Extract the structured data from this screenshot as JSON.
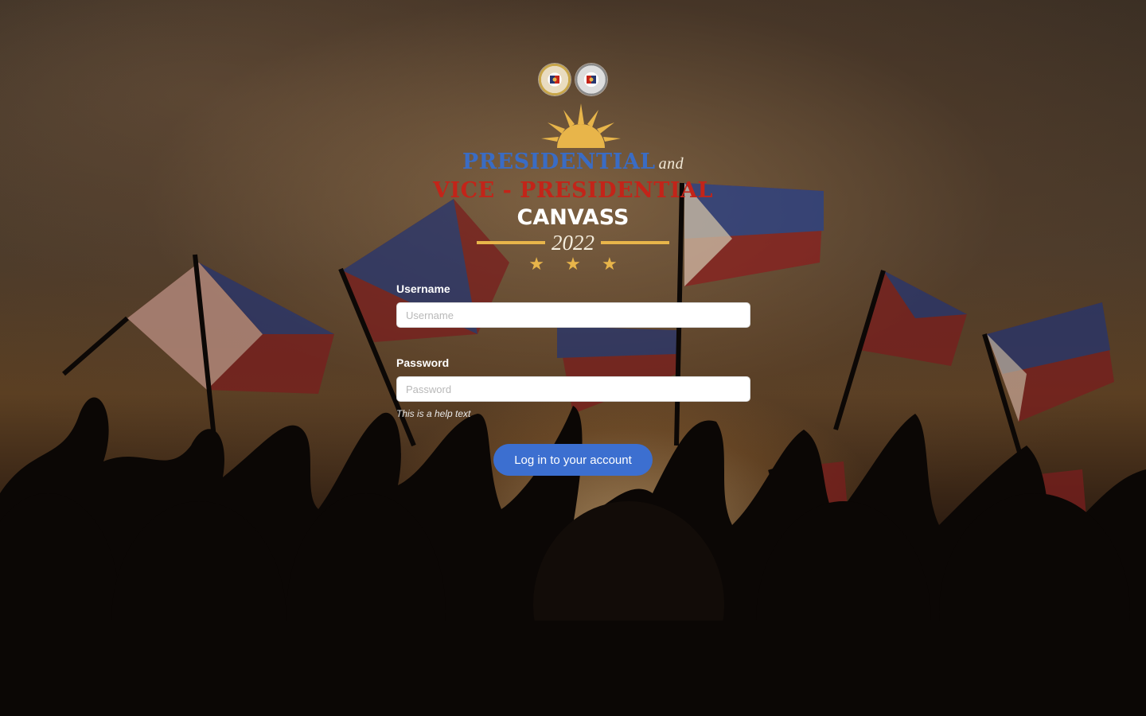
{
  "brand": {
    "line1": "PRESIDENTIAL",
    "line1_suffix": "and",
    "line2": "VICE - PRESIDENTIAL",
    "line3": "CANVASS",
    "year": "2022",
    "stars": "★ ★ ★"
  },
  "logos": [
    {
      "icon": "senate-seal-icon"
    },
    {
      "icon": "house-seal-icon"
    }
  ],
  "form": {
    "username_label": "Username",
    "username_placeholder": "Username",
    "username_value": "",
    "password_label": "Password",
    "password_placeholder": "Password",
    "password_value": "",
    "help_text": "This is a help text",
    "submit_label": "Log in to your account"
  },
  "colors": {
    "primary_button": "#3c6fd0",
    "title_blue": "#3a6cc4",
    "title_red": "#c32419",
    "gold": "#e8b54a"
  }
}
